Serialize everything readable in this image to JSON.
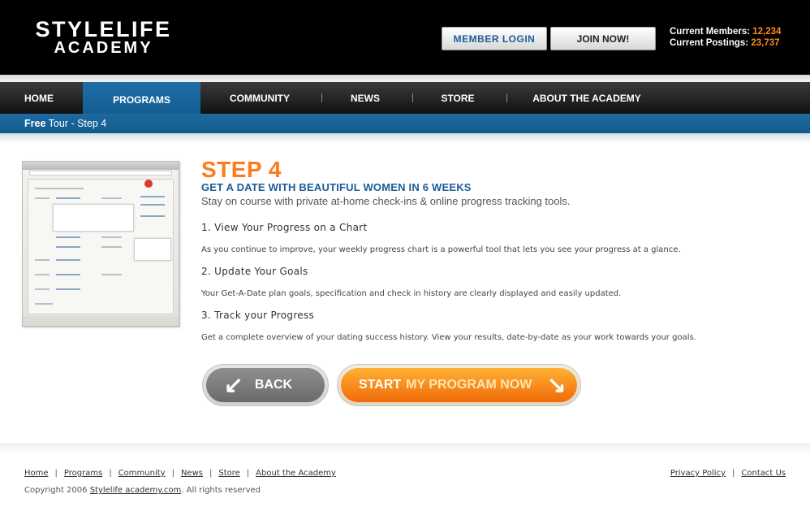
{
  "header": {
    "logo_line1": "STYLELIFE",
    "logo_line2": "ACADEMY",
    "member_login": "MEMBER LOGIN",
    "join_now": "JOIN NOW!",
    "members_label": "Current Members:",
    "members_value": "12,234",
    "postings_label": "Current Postings:",
    "postings_value": "23,737"
  },
  "nav": {
    "items": [
      {
        "label": "HOME"
      },
      {
        "label": "PROGRAMS"
      },
      {
        "label": "COMMUNITY"
      },
      {
        "label": "NEWS"
      },
      {
        "label": "STORE"
      },
      {
        "label": "ABOUT THE ACADEMY"
      }
    ],
    "active": "PROGRAMS"
  },
  "breadcrumb": {
    "free": "Free",
    "rest": "Tour - Step 4"
  },
  "content": {
    "step": "STEP 4",
    "headline": "GET A DATE WITH BEAUTIFUL WOMEN IN 6 WEEKS",
    "tagline": "Stay on course with private at-home check-ins & online progress tracking tools.",
    "sections": [
      {
        "title": "1. View Your Progress on a Chart",
        "body": "As you continue to improve, your weekly progress chart is a powerful tool that lets you see your progress at a glance."
      },
      {
        "title": "2. Update Your Goals",
        "body": "Your Get-A-Date plan goals, specification and check in history are clearly displayed and easily updated."
      },
      {
        "title": "3. Track your Progress",
        "body": "Get a complete overview of your dating success history. View your results, date-by-date as your work towards your goals."
      }
    ]
  },
  "buttons": {
    "back": "BACK",
    "start_bold": "START",
    "start_rest": "MY PROGRAM NOW"
  },
  "footer": {
    "links": [
      "Home",
      "Programs",
      "Community",
      "News",
      "Store",
      "About the Academy"
    ],
    "right_links": [
      "Privacy Policy",
      "Contact Us"
    ],
    "copyright_prefix": "Copyright 2006",
    "copyright_link": "Stylelife academy.com",
    "copyright_suffix": ".  All rights reserved"
  },
  "colors": {
    "accent_orange": "#ff7a1a",
    "brand_blue": "#1d5b95",
    "header_bg": "#000000"
  }
}
